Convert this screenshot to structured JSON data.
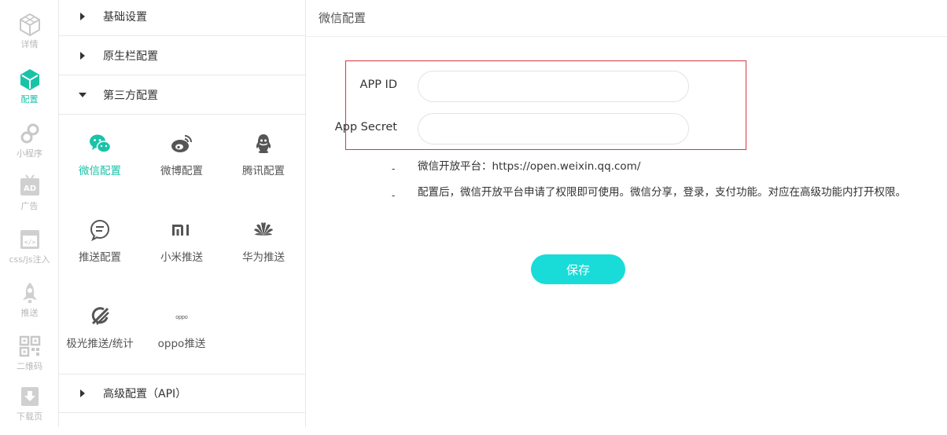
{
  "rail": {
    "items": [
      {
        "label": "详情",
        "icon": "cube-outline-icon"
      },
      {
        "label": "配置",
        "icon": "cube-filled-icon",
        "active": true
      },
      {
        "label": "小程序",
        "icon": "miniprogram-icon"
      },
      {
        "label": "广告",
        "icon": "ad-icon"
      },
      {
        "label": "css/js注入",
        "icon": "code-icon"
      },
      {
        "label": "推送",
        "icon": "rocket-icon"
      },
      {
        "label": "二维码",
        "icon": "qrcode-icon"
      },
      {
        "label": "下载页",
        "icon": "download-icon"
      }
    ],
    "active_color": "#19c3a8",
    "inactive_color": "#c8c8c8"
  },
  "menu": {
    "sections": {
      "basic": "基础设置",
      "native_bar": "原生栏配置",
      "third_party": "第三方配置",
      "advanced": "高级配置（API）"
    },
    "third_party_items": [
      {
        "label": "微信配置",
        "icon": "wechat-icon",
        "active": true
      },
      {
        "label": "微博配置",
        "icon": "weibo-icon"
      },
      {
        "label": "腾讯配置",
        "icon": "qq-icon"
      },
      {
        "label": "推送配置",
        "icon": "chat-bubble-icon"
      },
      {
        "label": "小米推送",
        "icon": "xiaomi-icon"
      },
      {
        "label": "华为推送",
        "icon": "huawei-icon"
      },
      {
        "label": "极光推送/统计",
        "icon": "jiguang-icon"
      },
      {
        "label": "oppo推送",
        "icon": "oppo-icon",
        "icon_text": "oppo"
      }
    ]
  },
  "main": {
    "title": "微信配置",
    "fields": {
      "app_id_label": "APP ID",
      "app_id_value": "",
      "app_secret_label": "App Secret",
      "app_secret_value": ""
    },
    "notes": {
      "dash": "-",
      "platform": "微信开放平台：https://open.weixin.qq.com/",
      "usage": "配置后，微信开放平台申请了权限即可使用。微信分享，登录，支付功能。对应在高级功能内打开权限。"
    },
    "save_label": "保存",
    "button_color": "#19dcd9",
    "highlight_color": "#d9363e"
  }
}
